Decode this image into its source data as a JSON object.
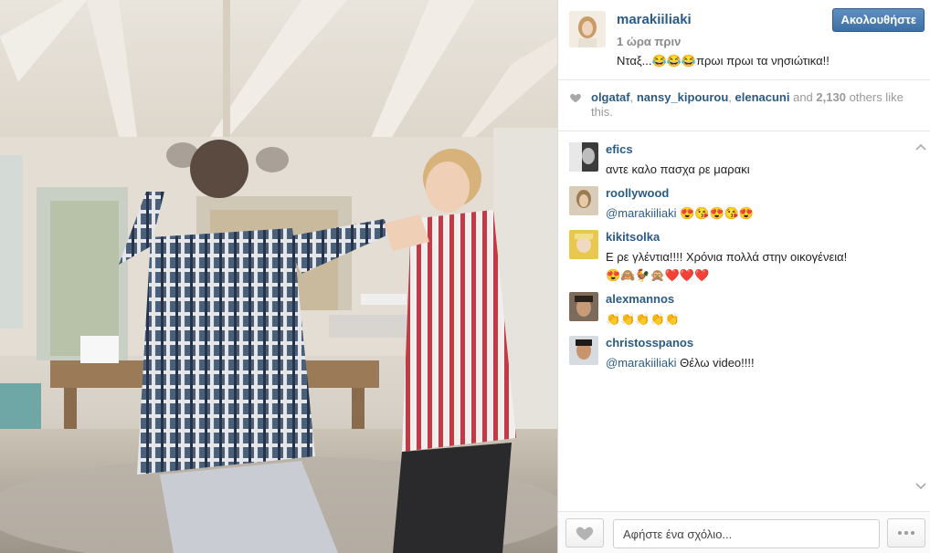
{
  "post": {
    "username": "marakiiliaki",
    "time": "1 ώρα πριν",
    "caption": "Νταξ...😂😂😂πρωι πρωι τα νησιώτικα!!",
    "follow_label": "Ακολουθήστε"
  },
  "likes": {
    "users": [
      "olgataf",
      "nansy_kipourou",
      "elenacuni"
    ],
    "sep1": ", ",
    "sep2": ", ",
    "and_text": " and ",
    "count": "2,130",
    "suffix": " others like this."
  },
  "comments": [
    {
      "user": "efics",
      "text": "αντε καλο πασχα ρε μαρακι"
    },
    {
      "user": "roollywood",
      "mention": "@marakiiliaki",
      "text": " 😍😘😍😘😍"
    },
    {
      "user": "kikitsolka",
      "text": "Ε ρε γλέντια!!!! Χρόνια πολλά στην οικογένεια!",
      "text2": "😍🙈🐓🙊❤️❤️❤️"
    },
    {
      "user": "alexmannos",
      "text": "👏👏👏👏👏"
    },
    {
      "user": "christosspanos",
      "mention": "@marakiiliaki",
      "text": " Θέλω video!!!!"
    }
  ],
  "footer": {
    "comment_placeholder": "Αφήστε ένα σχόλιο..."
  },
  "icons": {
    "like": "heart-icon",
    "more": "ellipsis-icon",
    "scroll_up": "chevron-up-icon",
    "scroll_down": "chevron-down-icon"
  },
  "colors": {
    "link": "#2b5b84",
    "follow_button": "#3e70a6",
    "muted": "#999999"
  }
}
